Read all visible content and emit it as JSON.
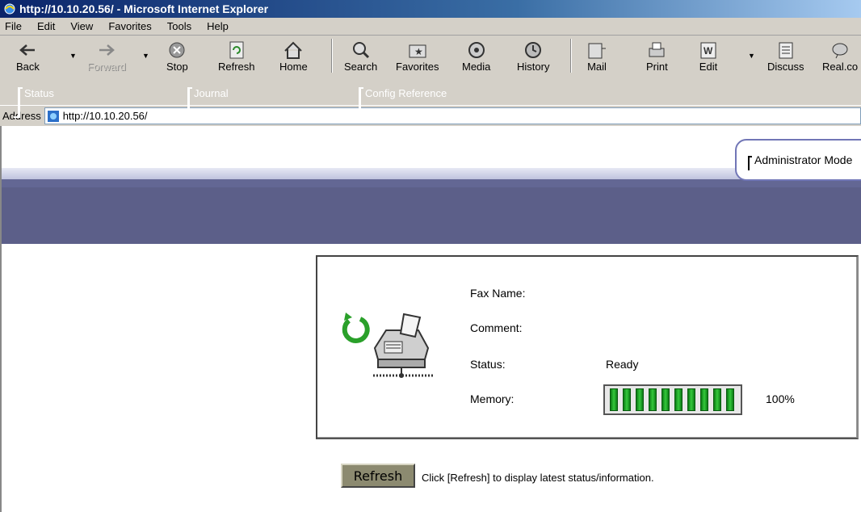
{
  "window": {
    "title": "http://10.10.20.56/ - Microsoft Internet Explorer"
  },
  "menu": {
    "items": [
      "File",
      "Edit",
      "View",
      "Favorites",
      "Tools",
      "Help"
    ]
  },
  "toolbar": {
    "back": "Back",
    "forward": "Forward",
    "stop": "Stop",
    "refresh": "Refresh",
    "home": "Home",
    "search": "Search",
    "favorites": "Favorites",
    "media": "Media",
    "history": "History",
    "mail": "Mail",
    "print": "Print",
    "edit": "Edit",
    "discuss": "Discuss",
    "real": "Real.co"
  },
  "address": {
    "label": "Address",
    "url": "http://10.10.20.56/"
  },
  "page": {
    "admin_mode": "Administrator Mode",
    "tabs": [
      "Status",
      "Journal",
      "Config Reference"
    ],
    "status_panel": {
      "fax_name_label": "Fax Name:",
      "fax_name_value": "",
      "comment_label": "Comment:",
      "comment_value": "",
      "status_label": "Status:",
      "status_value": "Ready",
      "memory_label": "Memory:",
      "memory_percent": "100%",
      "memory_fraction": 1.0
    },
    "refresh_button": "Refresh",
    "refresh_hint": "Click [Refresh] to display latest status/information."
  },
  "colors": {
    "nav_bg": "#5c5f89",
    "memory_fill": "#34c93c",
    "refresh_btn": "#8c8a70"
  }
}
